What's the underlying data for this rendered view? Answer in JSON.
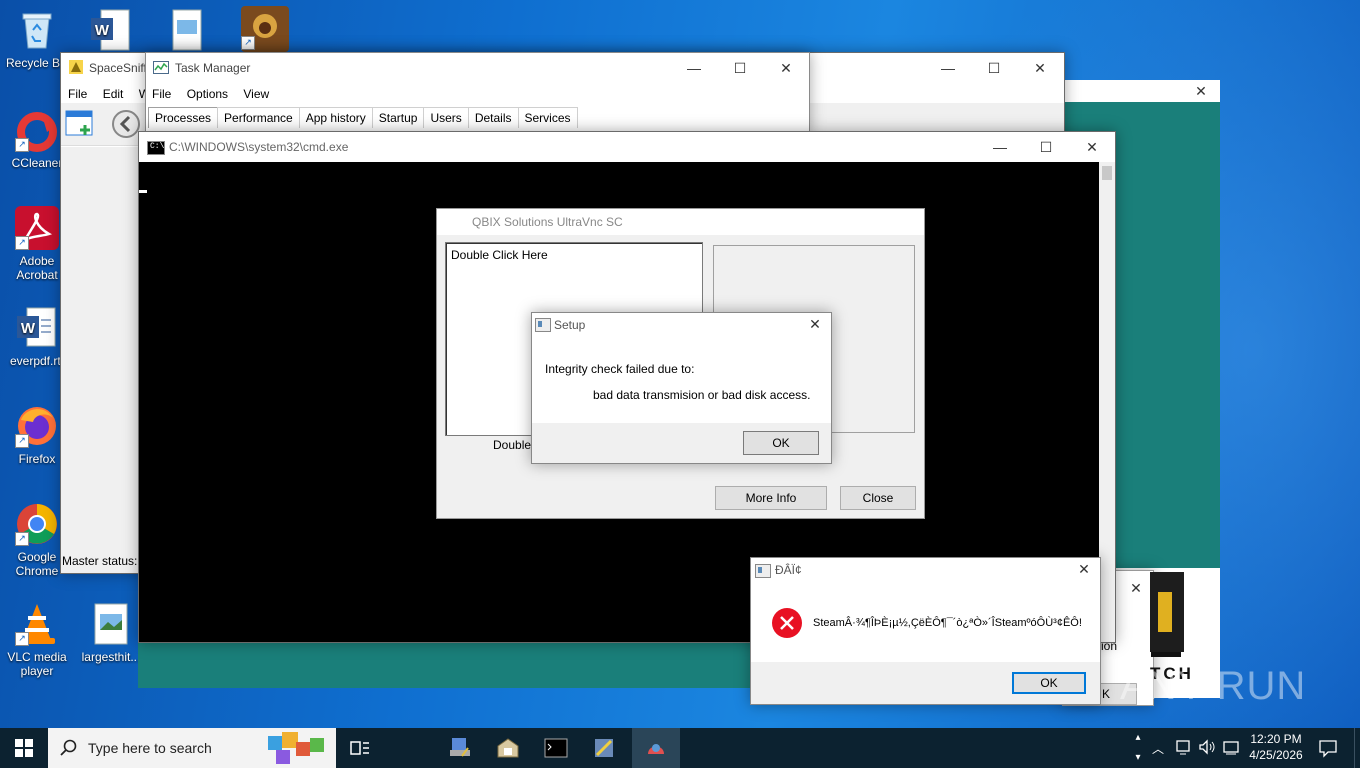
{
  "desktop": {
    "icons": [
      {
        "label": "Recycle Bin",
        "name": "recycle-bin-icon"
      },
      {
        "label": "CCleaner",
        "name": "ccleaner-icon"
      },
      {
        "label": "Adobe Acrobat",
        "name": "adobe-acrobat-icon"
      },
      {
        "label": "everpdf.rtf",
        "name": "word-document-icon"
      },
      {
        "label": "Firefox",
        "name": "firefox-icon"
      },
      {
        "label": "Google Chrome",
        "name": "chrome-icon"
      },
      {
        "label": "VLC media player",
        "name": "vlc-icon"
      },
      {
        "label": "largesthit...",
        "name": "image-file-icon"
      }
    ]
  },
  "spacesniffer": {
    "title": "SpaceSniff",
    "menu": [
      "File",
      "Edit",
      "W"
    ],
    "status": "Master status:"
  },
  "taskmanager": {
    "title": "Task Manager",
    "menu": [
      "File",
      "Options",
      "View"
    ],
    "tabs": [
      "Processes",
      "Performance",
      "App history",
      "Startup",
      "Users",
      "Details",
      "Services"
    ]
  },
  "cmd": {
    "title": "C:\\WINDOWS\\system32\\cmd.exe"
  },
  "ultravnc": {
    "title": "QBIX Solutions UltraVnc SC",
    "list_item": "Double Click Here",
    "caption_partial": "Double C",
    "more_info": "More Info",
    "close": "Close"
  },
  "setup_dialog": {
    "title": "Setup",
    "line1": "Integrity check failed due to:",
    "line2": "bad data transmision or bad disk access.",
    "ok": "OK"
  },
  "error_dialog": {
    "title": "ĐÂÏ¢",
    "message": "SteamÂ·¾¶ÎÞÈ¡µ½,ÇëÈÔ¶¯´ò¿ªÒ»´ÎSteamºóÔÙ³¢ÊÔ!",
    "ok": "OK"
  },
  "behind_dialog": {
    "partial_text": "ion",
    "partial_btn": "K",
    "partial_brand": "TCH"
  },
  "watermark": "ANY RUN",
  "taskbar": {
    "search_placeholder": "Type here to search",
    "time": "12:20 PM",
    "date": "4/25/2026"
  },
  "colors": {
    "taskbar_bg": "#0c2230",
    "accent": "#0078d7",
    "teal_window": "#1a7f7a",
    "error_red": "#e81123"
  }
}
